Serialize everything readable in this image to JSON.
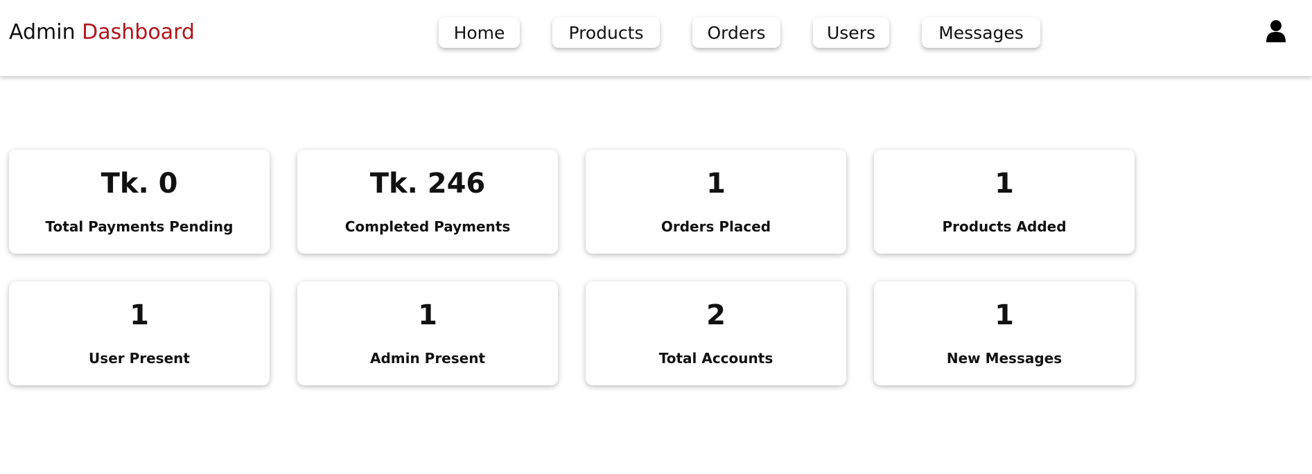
{
  "header": {
    "logo_primary": "Admin",
    "logo_accent": "Dashboard",
    "accent_color": "#b3141b",
    "nav": [
      {
        "label": "Home"
      },
      {
        "label": "Products"
      },
      {
        "label": "Orders"
      },
      {
        "label": "Users"
      },
      {
        "label": "Messages"
      }
    ],
    "user_icon": "user-icon"
  },
  "stats": [
    {
      "value": "Tk. 0",
      "label": "Total Payments Pending"
    },
    {
      "value": "Tk. 246",
      "label": "Completed Payments"
    },
    {
      "value": "1",
      "label": "Orders Placed"
    },
    {
      "value": "1",
      "label": "Products Added"
    },
    {
      "value": "1",
      "label": "User Present"
    },
    {
      "value": "1",
      "label": "Admin Present"
    },
    {
      "value": "2",
      "label": "Total Accounts"
    },
    {
      "value": "1",
      "label": "New Messages"
    }
  ]
}
